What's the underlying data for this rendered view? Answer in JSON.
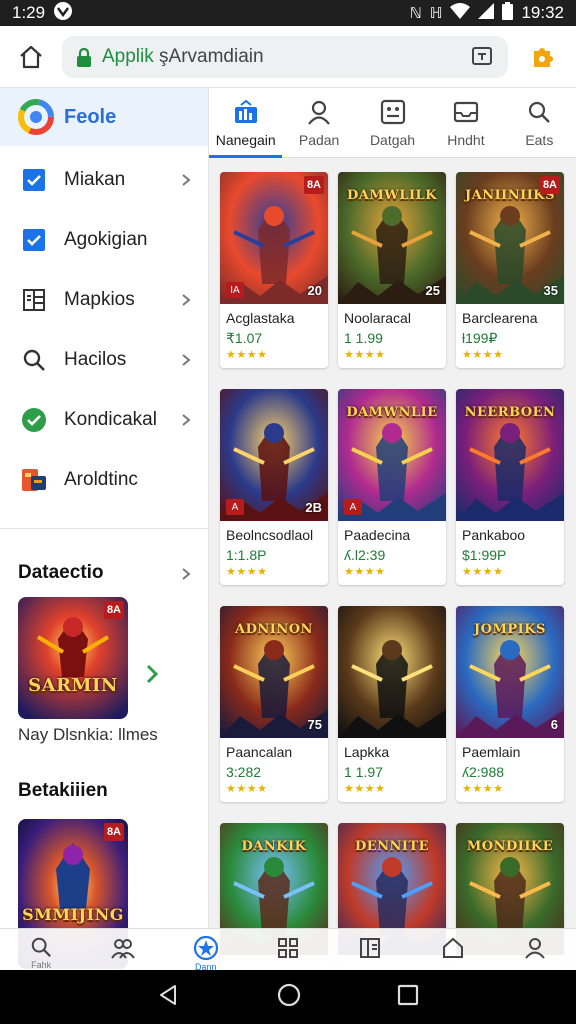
{
  "status_bar": {
    "time": "1:29",
    "right_time": "19:32"
  },
  "browser": {
    "url_green": "Applik",
    "url_rest": " şArvamdiain"
  },
  "sidebar": {
    "header_label": "Feole",
    "items": [
      {
        "label": "Miakan",
        "icon": "checkbox-checked-icon",
        "has_chevron": true
      },
      {
        "label": "Agokigian",
        "icon": "checkbox-checked-icon",
        "has_chevron": false
      },
      {
        "label": "Mapkios",
        "icon": "grid-list-icon",
        "has_chevron": true
      },
      {
        "label": "Hacilos",
        "icon": "search-icon",
        "has_chevron": true
      },
      {
        "label": "Kondicakal",
        "icon": "green-check-circle-icon",
        "has_chevron": true
      },
      {
        "label": "Aroldtinc",
        "icon": "colored-apps-icon",
        "has_chevron": false
      }
    ],
    "section1": {
      "title": "Dataectio",
      "promo_badge": "8A",
      "promo_title": "SARMIN",
      "promo_caption": "Nay DƖsnkia: llmes"
    },
    "section2": {
      "title": "Betakiiien",
      "promo_badge": "8A",
      "promo_title": "SMMIJING"
    }
  },
  "tabs": [
    {
      "label": "Nanegain",
      "icon": "chart-icon",
      "active": true
    },
    {
      "label": "Padan",
      "icon": "person-icon",
      "active": false
    },
    {
      "label": "Datgah",
      "icon": "face-box-icon",
      "active": false
    },
    {
      "label": "Hndht",
      "icon": "inbox-icon",
      "active": false
    },
    {
      "label": "Eats",
      "icon": "search-icon",
      "active": false
    }
  ],
  "cards": [
    {
      "name": "Acglastaka",
      "price": "₹1.07",
      "rating": 4,
      "art_title": "",
      "badge": "8A",
      "badge_bl": "IA",
      "num": "20"
    },
    {
      "name": "Noolaracal",
      "price": "1 1.99",
      "rating": 4,
      "art_title": "DAMWLILK",
      "badge": "",
      "badge_bl": "",
      "num": "25"
    },
    {
      "name": "Barclearena",
      "price": "ƚ199₽",
      "rating": 4,
      "art_title": "JANIINIIKS",
      "badge": "8A",
      "badge_bl": "",
      "num": "35"
    },
    {
      "name": "Beolncsodlaol",
      "price": "1:1.8P",
      "rating": 4,
      "art_title": "",
      "badge": "",
      "badge_bl": "A",
      "num": "2B"
    },
    {
      "name": "Paadecina",
      "price": "ʎ.Ɩ2:39",
      "rating": 4,
      "art_title": "DAMWNLIE",
      "badge": "",
      "badge_bl": "A",
      "num": ""
    },
    {
      "name": "Pankaboo",
      "price": "$1:99P",
      "rating": 4,
      "art_title": "NEERBOEN",
      "badge": "",
      "badge_bl": "",
      "num": ""
    },
    {
      "name": "Paancalan",
      "price": "3:282",
      "rating": 4,
      "art_title": "ADNINON",
      "badge": "",
      "badge_bl": "",
      "num": "75"
    },
    {
      "name": "Lapkka",
      "price": "1 1.97",
      "rating": 4,
      "art_title": "",
      "badge": "",
      "badge_bl": "",
      "num": ""
    },
    {
      "name": "Paemlain",
      "price": "ʎ2:988",
      "rating": 4,
      "art_title": "JOMPIKS",
      "badge": "",
      "badge_bl": "",
      "num": "6"
    },
    {
      "name": "",
      "price": "",
      "rating": 0,
      "art_title": "DANKIK",
      "badge": "",
      "badge_bl": "",
      "num": ""
    },
    {
      "name": "",
      "price": "",
      "rating": 0,
      "art_title": "DENNITE",
      "badge": "",
      "badge_bl": "",
      "num": ""
    },
    {
      "name": "",
      "price": "",
      "rating": 0,
      "art_title": "MONDIIKE",
      "badge": "",
      "badge_bl": "",
      "num": ""
    }
  ],
  "bottom_bar": [
    {
      "icon": "search-icon",
      "label": "Fahk"
    },
    {
      "icon": "people-icon",
      "label": ""
    },
    {
      "icon": "star-circle-icon",
      "label": "Dann"
    },
    {
      "icon": "grid-icon",
      "label": ""
    },
    {
      "icon": "split-panel-icon",
      "label": ""
    },
    {
      "icon": "home-icon",
      "label": ""
    },
    {
      "icon": "person-icon",
      "label": ""
    }
  ],
  "colors": {
    "accent": "#1a73e8",
    "price_green": "#1e7c36",
    "star": "#e6b400",
    "badge_red": "#b71c1c"
  }
}
